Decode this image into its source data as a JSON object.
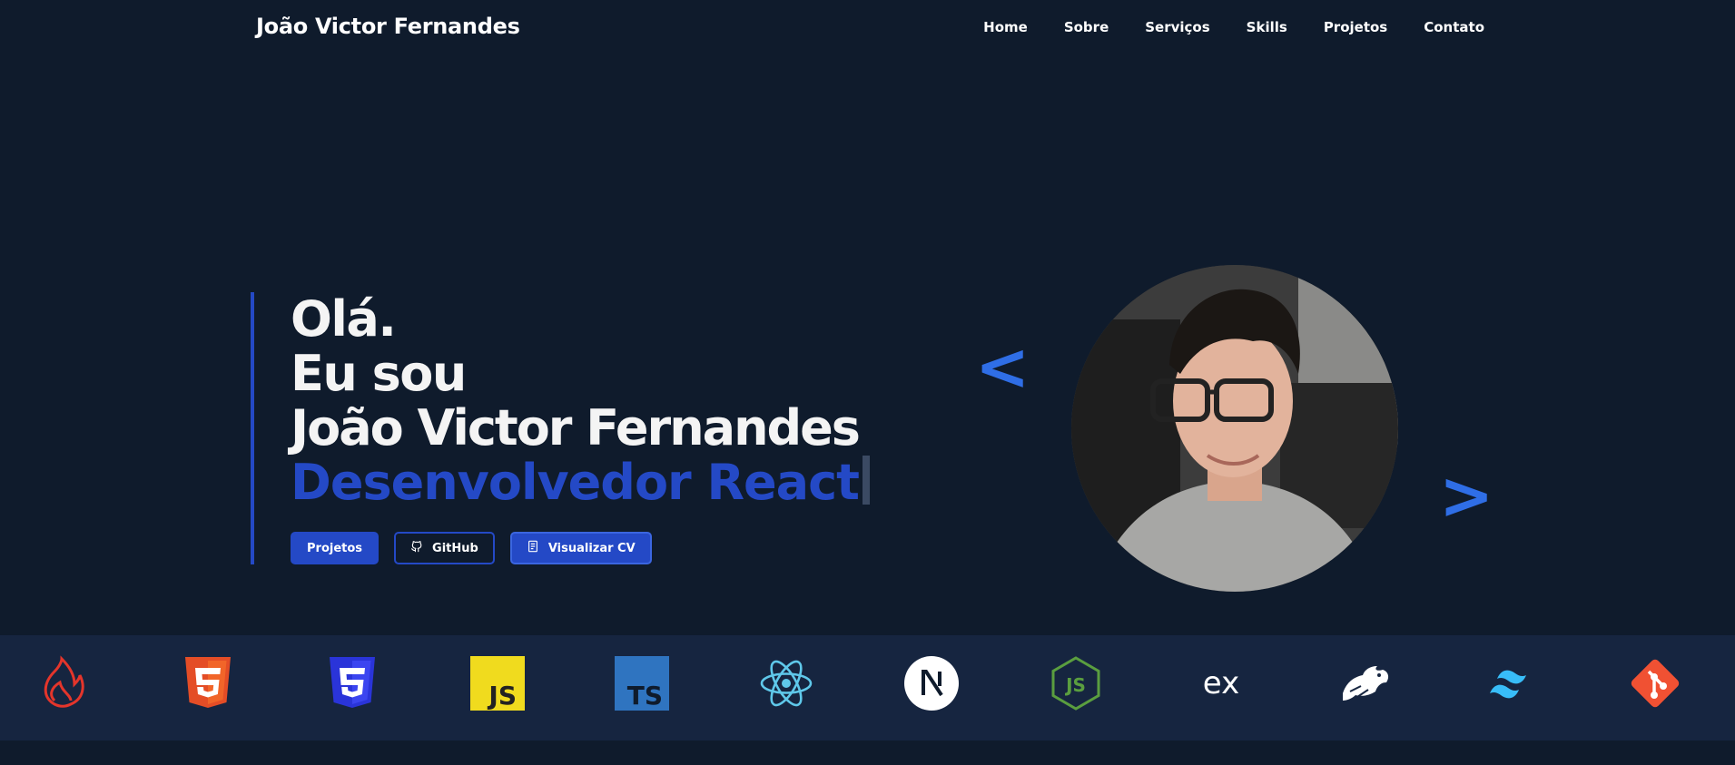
{
  "header": {
    "brand": "João Victor Fernandes",
    "nav": [
      "Home",
      "Sobre",
      "Serviços",
      "Skills",
      "Projetos",
      "Contato"
    ]
  },
  "hero": {
    "greeting": "Olá.",
    "intro": "Eu sou",
    "name": "João Victor Fernandes",
    "role": "Desenvolvedor React",
    "buttons": {
      "projects": "Projetos",
      "github": "GitHub",
      "cv": "Visualizar CV"
    },
    "bracket_left": "<",
    "bracket_right": ">"
  },
  "tech_icons": [
    "firebase-icon",
    "html5-icon",
    "css3-icon",
    "javascript-icon",
    "typescript-icon",
    "react-icon",
    "nextjs-icon",
    "nodejs-icon",
    "express-icon",
    "nestjs-icon",
    "tailwind-icon",
    "git-icon"
  ],
  "colors": {
    "background": "#0f1b2c",
    "strip": "#162540",
    "accent": "#2449c6",
    "bracket": "#2f6ee6"
  }
}
